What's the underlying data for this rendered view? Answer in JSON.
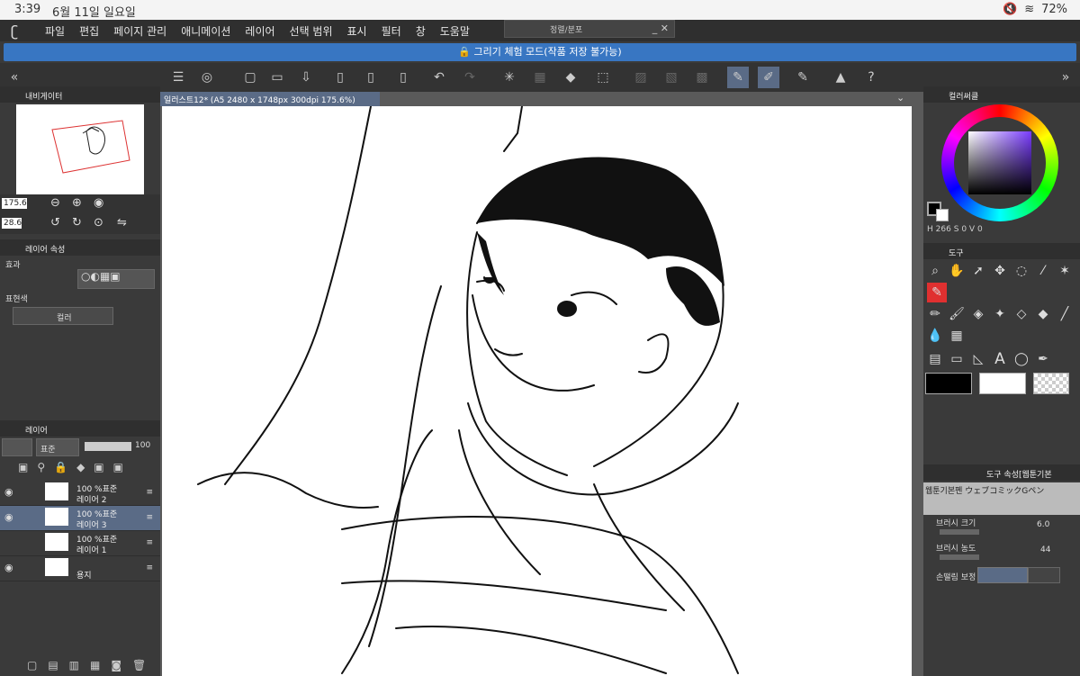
{
  "status": {
    "time": "3:39",
    "date": "6월 11일 일요일",
    "battery": "72%"
  },
  "menu": [
    "파일",
    "편집",
    "페이지 관리",
    "애니메이션",
    "레이어",
    "선택 범위",
    "표시",
    "필터",
    "창",
    "도움말"
  ],
  "float_panel_title": "정렬/분포",
  "mode_banner": "그리기 체험 모드(작품 저장 불가능)",
  "doc_tab": "일러스트12* (A5 2480 x 1748px 300dpi 175.6%)",
  "navigator": {
    "title": "내비게이터",
    "zoom": "175.6",
    "rotate": "28.6"
  },
  "layer_props": {
    "title": "레이어 속성",
    "effect": "효과",
    "color_label": "표현색",
    "color_value": "컬러"
  },
  "layers": {
    "title": "레이어",
    "blend": "표준",
    "opacity": "100",
    "rows": [
      {
        "top": "100 %표준",
        "name": "레이어 2"
      },
      {
        "top": "100 %표준",
        "name": "레이어 3"
      },
      {
        "top": "100 %표준",
        "name": "레이어 1"
      },
      {
        "top": "",
        "name": "용지"
      }
    ]
  },
  "color_wheel": {
    "title": "컬러써클",
    "h": "266",
    "s": "0",
    "v": "0",
    "h_label": "H",
    "s_label": "S",
    "v_label": "V"
  },
  "tool_panel": {
    "title": "도구"
  },
  "tool_props": {
    "title": "도구 속성[웹툰기본",
    "brush_name": "웹툰기본펜 ウェブコミックGペン",
    "size_label": "브러시 크기",
    "size_value": "6.0",
    "density_label": "브러시 농도",
    "density_value": "44",
    "stab_label": "손떨림 보정"
  },
  "colors": {
    "accent": "#3876c2",
    "selected": "#5a6b86",
    "red_tool": "#e03030"
  }
}
